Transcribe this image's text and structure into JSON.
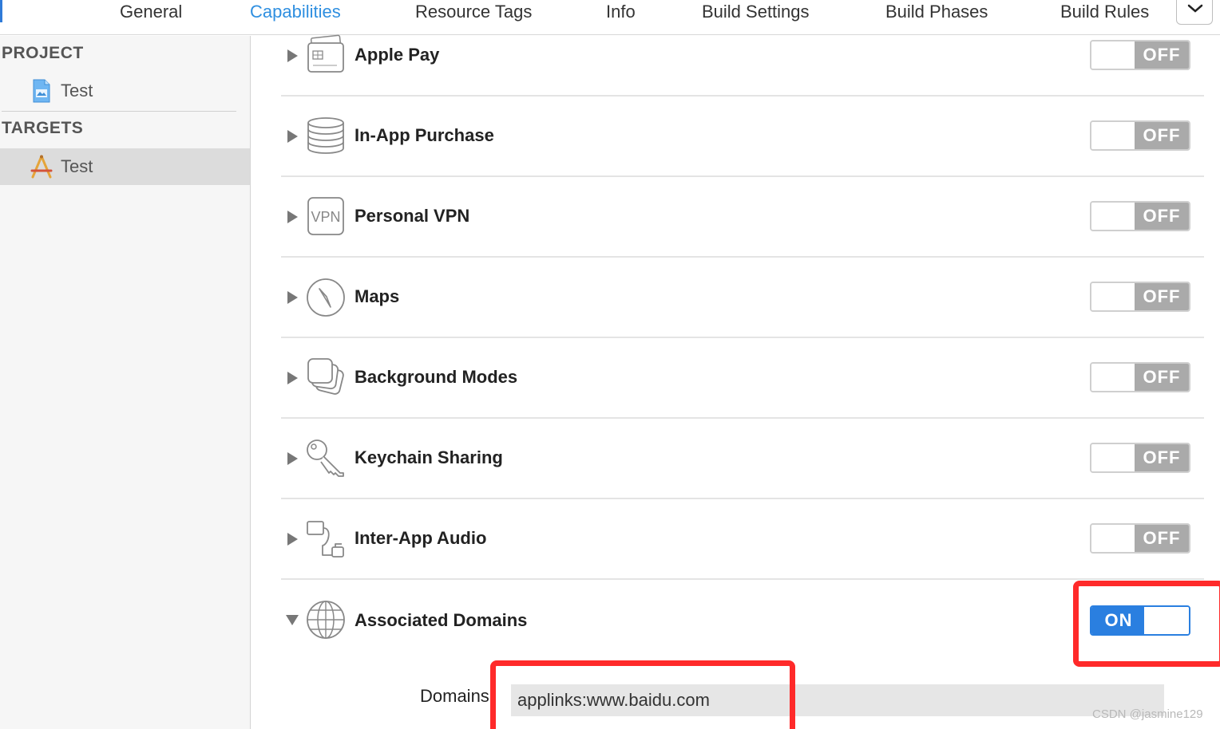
{
  "tabs": [
    {
      "label": "General"
    },
    {
      "label": "Capabilities"
    },
    {
      "label": "Resource Tags"
    },
    {
      "label": "Info"
    },
    {
      "label": "Build Settings"
    },
    {
      "label": "Build Phases"
    },
    {
      "label": "Build Rules"
    }
  ],
  "active_tab": "Capabilities",
  "sidebar": {
    "project_header": "PROJECT",
    "project_item": "Test",
    "targets_header": "TARGETS",
    "target_item": "Test"
  },
  "capabilities": [
    {
      "name": "Apple Pay",
      "icon": "wallet-icon",
      "state": "OFF",
      "expanded": false
    },
    {
      "name": "In-App Purchase",
      "icon": "coins-icon",
      "state": "OFF",
      "expanded": false
    },
    {
      "name": "Personal VPN",
      "icon": "vpn-icon",
      "state": "OFF",
      "expanded": false
    },
    {
      "name": "Maps",
      "icon": "compass-icon",
      "state": "OFF",
      "expanded": false
    },
    {
      "name": "Background Modes",
      "icon": "layers-icon",
      "state": "OFF",
      "expanded": false
    },
    {
      "name": "Keychain Sharing",
      "icon": "key-icon",
      "state": "OFF",
      "expanded": false
    },
    {
      "name": "Inter-App Audio",
      "icon": "audio-plug-icon",
      "state": "OFF",
      "expanded": false
    },
    {
      "name": "Associated Domains",
      "icon": "globe-icon",
      "state": "ON",
      "expanded": true
    }
  ],
  "vpn_icon_text": "VPN",
  "domains": {
    "label": "Domains",
    "value": "applinks:www.baidu.com"
  },
  "watermark": "CSDN @jasmine129",
  "colors": {
    "accent": "#2f8fe0",
    "switch_on": "#2a7fe0",
    "switch_off": "#aaaaaa",
    "highlight": "#ff2a2a"
  }
}
